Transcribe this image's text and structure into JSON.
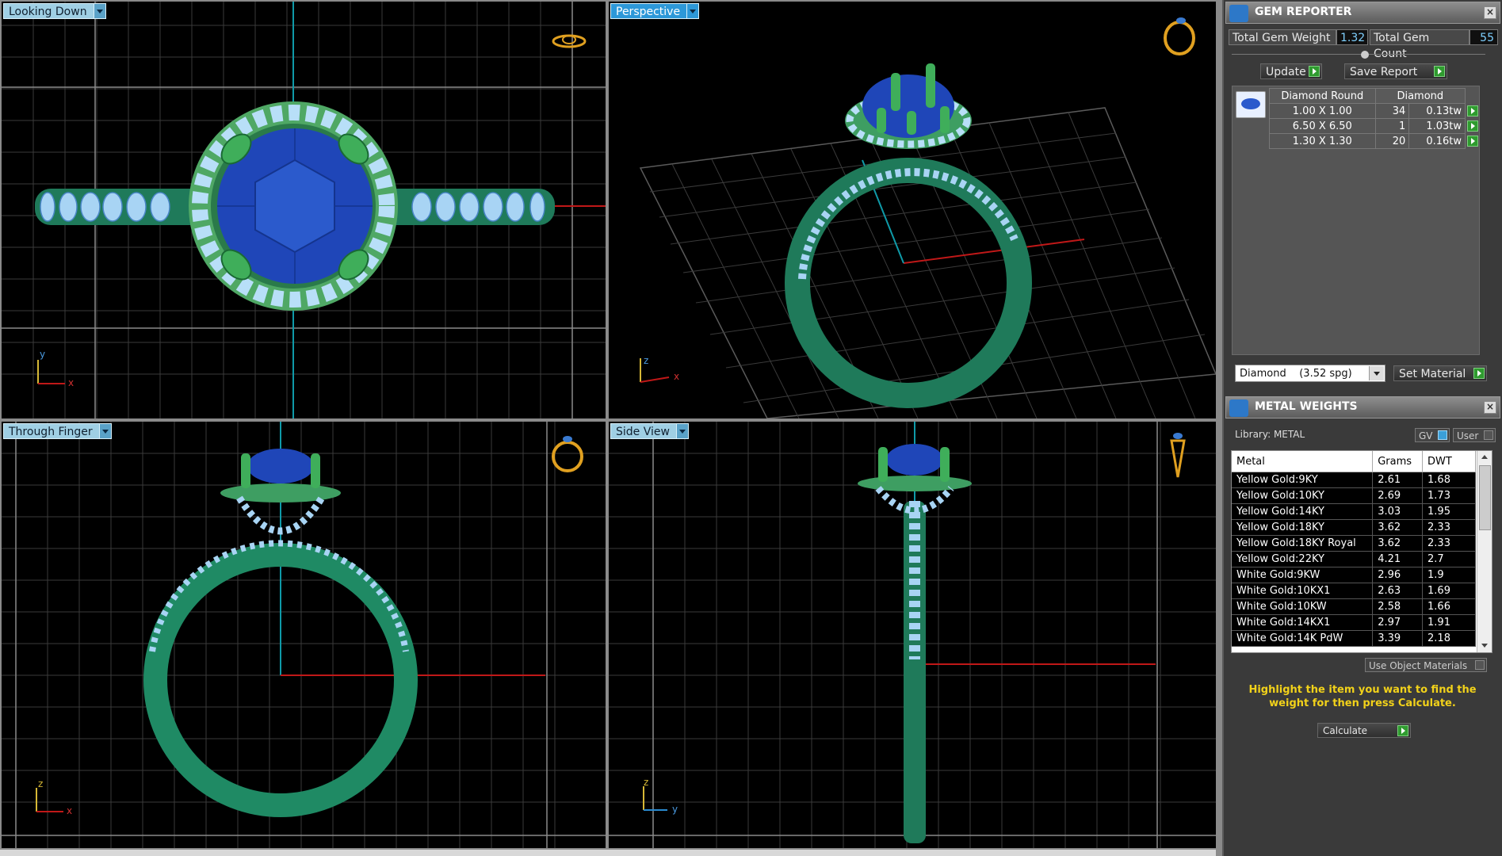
{
  "viewports": {
    "top_left": {
      "label": "Looking Down",
      "axes": {
        "v": "y",
        "h": "x"
      }
    },
    "top_right": {
      "label": "Perspective",
      "axes": {
        "v": "z",
        "h": "x"
      }
    },
    "bottom_left": {
      "label": "Through Finger",
      "axes": {
        "v": "z",
        "h": "x"
      }
    },
    "bottom_right": {
      "label": "Side View",
      "axes": {
        "v": "z",
        "h": "y"
      }
    }
  },
  "gem_reporter": {
    "title": "GEM REPORTER",
    "total_weight_label": "Total Gem Weight",
    "total_weight_value": "1.32",
    "total_count_label": "Total Gem Count",
    "total_count_value": "55",
    "update_label": "Update",
    "save_report_label": "Save Report",
    "table_headers": [
      "Diamond Round",
      "Diamond"
    ],
    "rows": [
      {
        "size": "1.00 X 1.00",
        "count": "34",
        "weight": "0.13tw"
      },
      {
        "size": "6.50 X 6.50",
        "count": "1",
        "weight": "1.03tw"
      },
      {
        "size": "1.30 X 1.30",
        "count": "20",
        "weight": "0.16tw"
      }
    ],
    "material_select": "Diamond    (3.52 spg)",
    "set_material_label": "Set Material"
  },
  "metal_weights": {
    "title": "METAL WEIGHTS",
    "library_label": "Library: METAL",
    "gv_label": "GV",
    "user_label": "User",
    "headers": [
      "Metal",
      "Grams",
      "DWT"
    ],
    "rows": [
      {
        "metal": "Yellow Gold:9KY",
        "grams": "2.61",
        "dwt": "1.68"
      },
      {
        "metal": "Yellow Gold:10KY",
        "grams": "2.69",
        "dwt": "1.73"
      },
      {
        "metal": "Yellow Gold:14KY",
        "grams": "3.03",
        "dwt": "1.95"
      },
      {
        "metal": "Yellow Gold:18KY",
        "grams": "3.62",
        "dwt": "2.33"
      },
      {
        "metal": "Yellow Gold:18KY Royal",
        "grams": "3.62",
        "dwt": "2.33"
      },
      {
        "metal": "Yellow Gold:22KY",
        "grams": "4.21",
        "dwt": "2.7"
      },
      {
        "metal": "White Gold:9KW",
        "grams": "2.96",
        "dwt": "1.9"
      },
      {
        "metal": "White Gold:10KX1",
        "grams": "2.63",
        "dwt": "1.69"
      },
      {
        "metal": "White Gold:10KW",
        "grams": "2.58",
        "dwt": "1.66"
      },
      {
        "metal": "White Gold:14KX1",
        "grams": "2.97",
        "dwt": "1.91"
      },
      {
        "metal": "White Gold:14K PdW",
        "grams": "3.39",
        "dwt": "2.18"
      }
    ],
    "use_object_materials_label": "Use Object Materials",
    "hint": "Highlight the item you want to find the weight for then press Calculate.",
    "calculate_label": "Calculate"
  }
}
